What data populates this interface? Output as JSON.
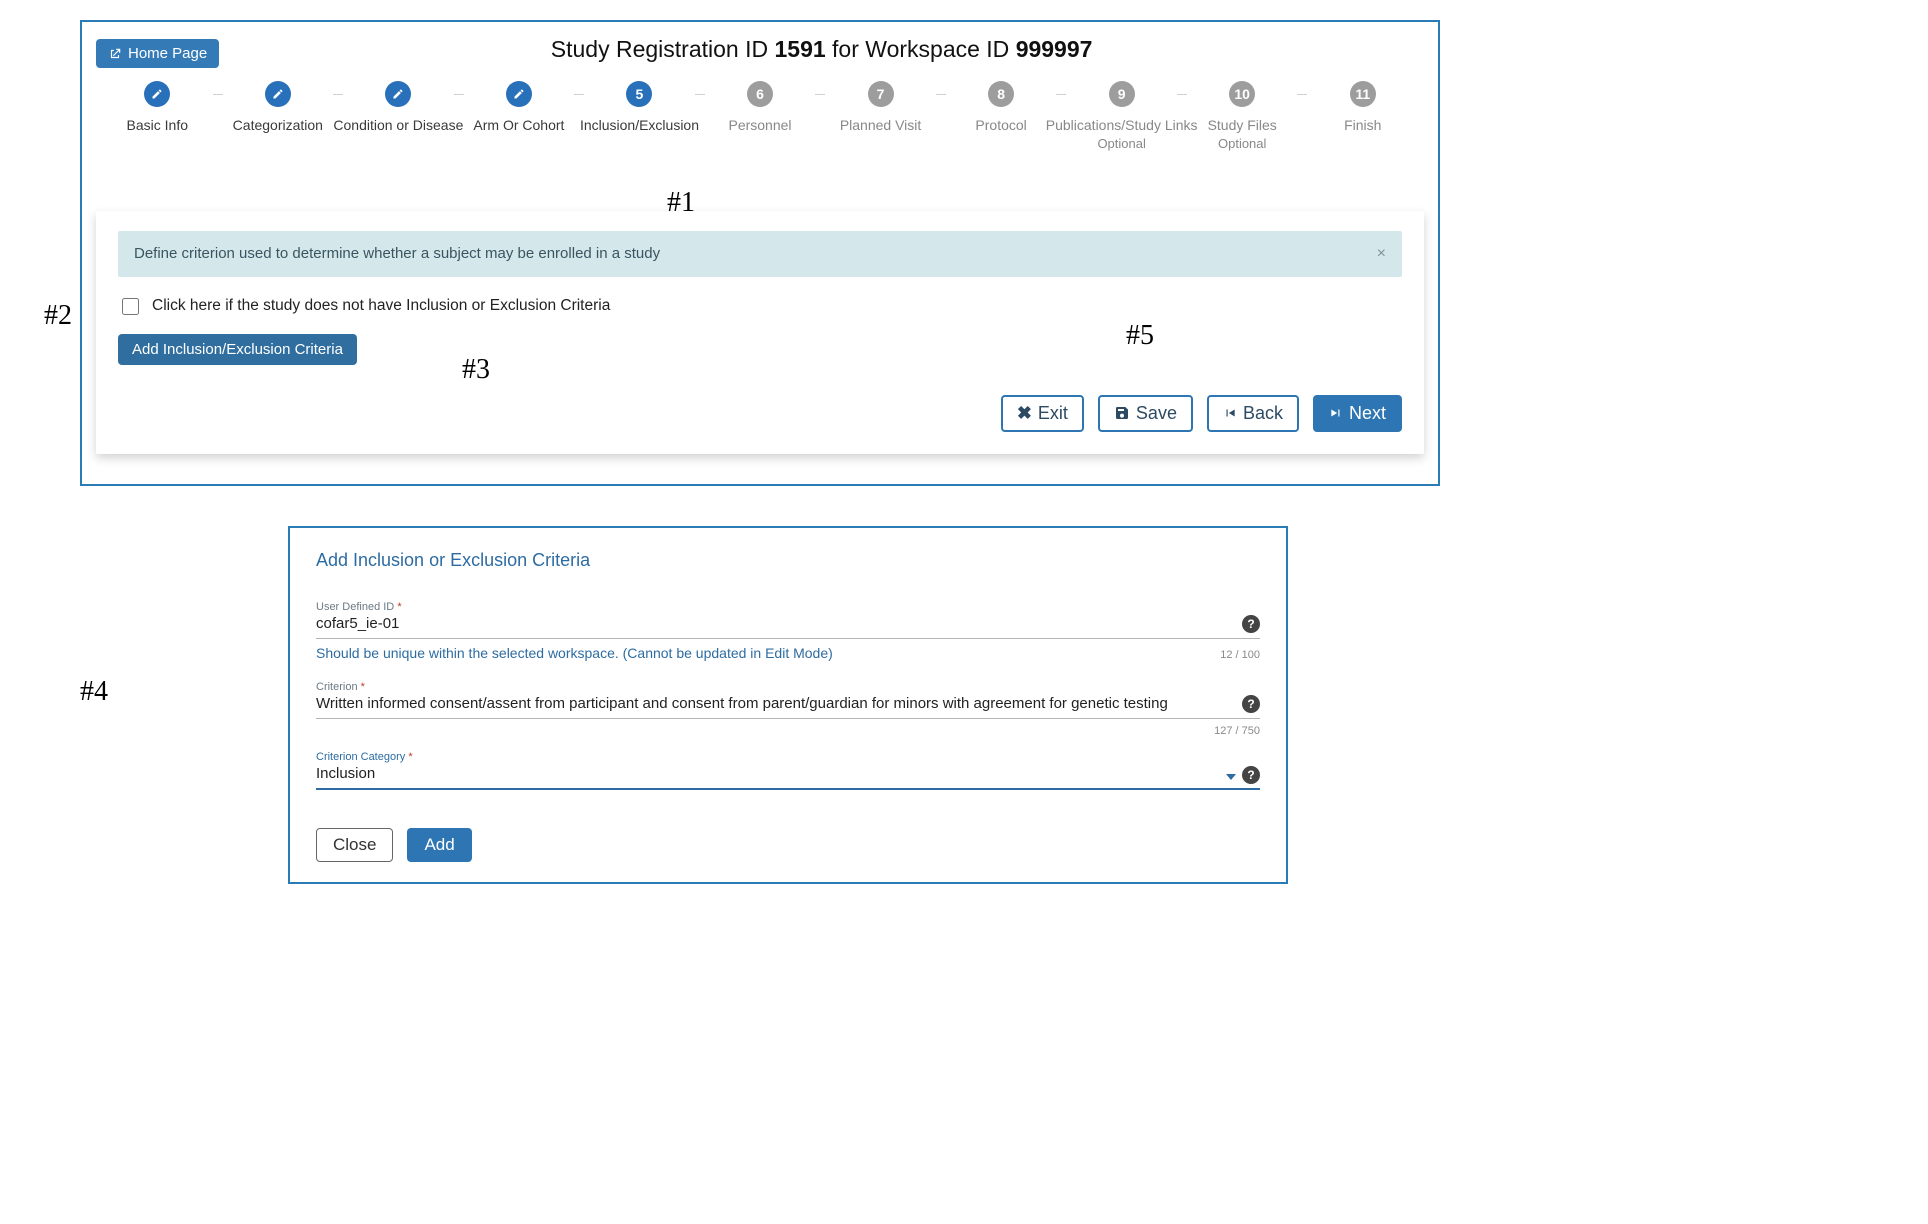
{
  "home_btn": "Home Page",
  "title_prefix": "Study Registration ID ",
  "title_id": "1591",
  "title_mid": " for Workspace ID ",
  "title_ws": "999997",
  "steps": [
    {
      "num": "",
      "label": "Basic Info",
      "sub": "",
      "kind": "done"
    },
    {
      "num": "",
      "label": "Categorization",
      "sub": "",
      "kind": "done"
    },
    {
      "num": "",
      "label": "Condition or Disease",
      "sub": "",
      "kind": "done"
    },
    {
      "num": "",
      "label": "Arm Or Cohort",
      "sub": "",
      "kind": "done"
    },
    {
      "num": "5",
      "label": "Inclusion/Exclusion",
      "sub": "",
      "kind": "current"
    },
    {
      "num": "6",
      "label": "Personnel",
      "sub": "",
      "kind": "future"
    },
    {
      "num": "7",
      "label": "Planned Visit",
      "sub": "",
      "kind": "future"
    },
    {
      "num": "8",
      "label": "Protocol",
      "sub": "",
      "kind": "future"
    },
    {
      "num": "9",
      "label": "Publications/Study Links",
      "sub": "Optional",
      "kind": "future"
    },
    {
      "num": "10",
      "label": "Study Files",
      "sub": "Optional",
      "kind": "future"
    },
    {
      "num": "11",
      "label": "Finish",
      "sub": "",
      "kind": "future"
    }
  ],
  "info_text": "Define criterion used to determine whether a subject may be enrolled in a study",
  "checkbox_label": "Click here if the study does not have Inclusion or Exclusion Criteria",
  "add_criteria_btn": "Add Inclusion/Exclusion Criteria",
  "btn_exit": "Exit",
  "btn_save": "Save",
  "btn_back": "Back",
  "btn_next": "Next",
  "anno1": "#1",
  "anno2": "#2",
  "anno3": "#3",
  "anno4": "#4",
  "anno5": "#5",
  "modal": {
    "title": "Add Inclusion or Exclusion Criteria",
    "udid_label": "User Defined ID",
    "udid_value": "cofar5_ie-01",
    "udid_hint": "Should be unique within the selected workspace. (Cannot be updated in Edit Mode)",
    "udid_counter": "12 / 100",
    "crit_label": "Criterion",
    "crit_value": "Written informed consent/assent from participant and consent from parent/guardian for minors with agreement for genetic testing",
    "crit_counter": "127 / 750",
    "cat_label": "Criterion Category",
    "cat_value": "Inclusion",
    "close": "Close",
    "add": "Add"
  }
}
